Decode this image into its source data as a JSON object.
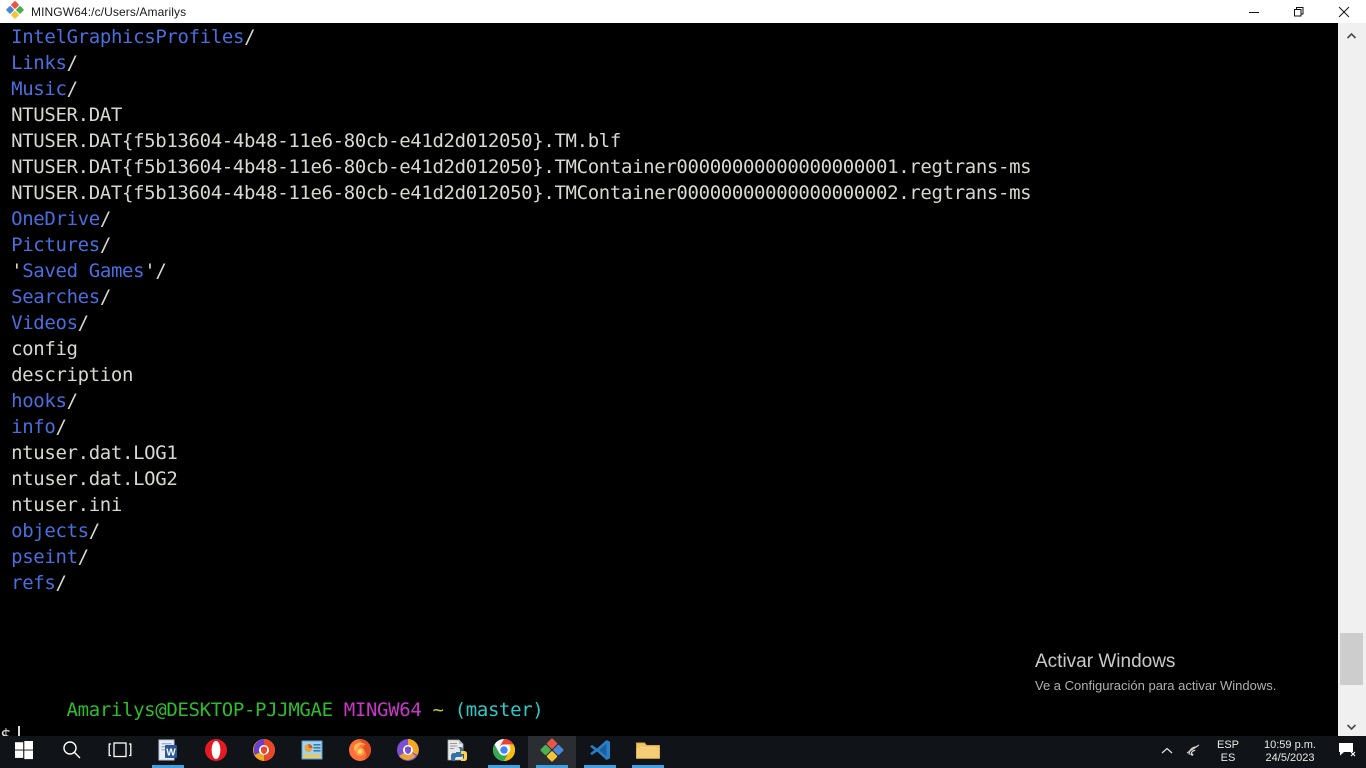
{
  "window": {
    "title": "MINGW64:/c/Users/Amarilys",
    "icon": "git-bash-icon",
    "controls": {
      "minimize": "minimize-icon",
      "restore": "restore-icon",
      "close": "close-icon"
    }
  },
  "terminal": {
    "lines": [
      {
        "text": "IntelGraphicsProfiles",
        "kind": "dir",
        "suffix": "/"
      },
      {
        "text": "Links",
        "kind": "dir",
        "suffix": "/"
      },
      {
        "text": "Music",
        "kind": "dir",
        "suffix": "/"
      },
      {
        "text": "NTUSER.DAT",
        "kind": "file",
        "suffix": ""
      },
      {
        "text": "NTUSER.DAT{f5b13604-4b48-11e6-80cb-e41d2d012050}.TM.blf",
        "kind": "file",
        "suffix": ""
      },
      {
        "text": "NTUSER.DAT{f5b13604-4b48-11e6-80cb-e41d2d012050}.TMContainer00000000000000000001.regtrans-ms",
        "kind": "file",
        "suffix": ""
      },
      {
        "text": "NTUSER.DAT{f5b13604-4b48-11e6-80cb-e41d2d012050}.TMContainer00000000000000000002.regtrans-ms",
        "kind": "file",
        "suffix": ""
      },
      {
        "text": "OneDrive",
        "kind": "dir",
        "suffix": "/"
      },
      {
        "text": "Pictures",
        "kind": "dir",
        "suffix": "/"
      },
      {
        "text": "'Saved Games'",
        "kind": "dir-quoted",
        "suffix": "/"
      },
      {
        "text": "Searches",
        "kind": "dir",
        "suffix": "/"
      },
      {
        "text": "Videos",
        "kind": "dir",
        "suffix": "/"
      },
      {
        "text": "config",
        "kind": "file",
        "suffix": ""
      },
      {
        "text": "description",
        "kind": "file",
        "suffix": ""
      },
      {
        "text": "hooks",
        "kind": "dir",
        "suffix": "/"
      },
      {
        "text": "info",
        "kind": "dir",
        "suffix": "/"
      },
      {
        "text": "ntuser.dat.LOG1",
        "kind": "file",
        "suffix": ""
      },
      {
        "text": "ntuser.dat.LOG2",
        "kind": "file",
        "suffix": ""
      },
      {
        "text": "ntuser.ini",
        "kind": "file",
        "suffix": ""
      },
      {
        "text": "objects",
        "kind": "dir",
        "suffix": "/"
      },
      {
        "text": "pseint",
        "kind": "dir",
        "suffix": "/"
      },
      {
        "text": "refs",
        "kind": "dir",
        "suffix": "/"
      }
    ],
    "prompt": {
      "user_host": "Amarilys@DESKTOP-PJJMGAE",
      "shell": "MINGW64",
      "path": "~",
      "git_branch": "(master)",
      "symbol": "$",
      "input": ""
    },
    "colors": {
      "background": "#000000",
      "dir": "#4a6ee0",
      "file": "#d8d8d0",
      "user_host": "#2dbd2d",
      "shell": "#c838c8",
      "path": "#c8c82d",
      "git_branch": "#2dc8c8"
    }
  },
  "watermark": {
    "title": "Activar Windows",
    "subtitle": "Ve a Configuración para activar Windows."
  },
  "scrollbar": {
    "up_arrow": "chevron-up-icon",
    "down_arrow": "chevron-down-icon"
  },
  "taskbar": {
    "items": [
      {
        "name": "start-button",
        "label": "Start",
        "icon": "windows-logo-icon",
        "state": "idle"
      },
      {
        "name": "search-button",
        "label": "Buscar",
        "icon": "search-icon",
        "state": "idle"
      },
      {
        "name": "task-view-button",
        "label": "Vista de tareas",
        "icon": "task-view-icon",
        "state": "idle"
      },
      {
        "name": "taskbar-word",
        "label": "Word",
        "icon": "word-icon",
        "state": "open"
      },
      {
        "name": "taskbar-opera",
        "label": "Opera",
        "icon": "opera-icon",
        "state": "idle"
      },
      {
        "name": "taskbar-avast-browser",
        "label": "Avast Secure Browser",
        "icon": "avast-browser-icon",
        "state": "idle"
      },
      {
        "name": "taskbar-powerpoint",
        "label": "PowerPoint",
        "icon": "powerpoint-icon",
        "state": "idle"
      },
      {
        "name": "taskbar-firefox",
        "label": "Firefox",
        "icon": "firefox-icon",
        "state": "idle"
      },
      {
        "name": "taskbar-avg-browser",
        "label": "AVG Secure Browser",
        "icon": "avg-browser-icon",
        "state": "idle"
      },
      {
        "name": "taskbar-python-file",
        "label": "Python",
        "icon": "python-file-icon",
        "state": "idle"
      },
      {
        "name": "taskbar-chrome",
        "label": "Google Chrome",
        "icon": "chrome-icon",
        "state": "open"
      },
      {
        "name": "taskbar-git-bash",
        "label": "Git Bash",
        "icon": "git-bash-icon",
        "state": "active"
      },
      {
        "name": "taskbar-vscode",
        "label": "Visual Studio Code",
        "icon": "vscode-icon",
        "state": "open"
      },
      {
        "name": "taskbar-file-explorer",
        "label": "Explorador de archivos",
        "icon": "folder-icon",
        "state": "open"
      }
    ],
    "tray": {
      "overflow": "chevron-up-icon",
      "network": "wifi-icon",
      "language_top": "ESP",
      "language_bottom": "ES",
      "time": "10:59 p.m.",
      "date": "24/5/2023",
      "action_center": "action-center-icon"
    }
  }
}
